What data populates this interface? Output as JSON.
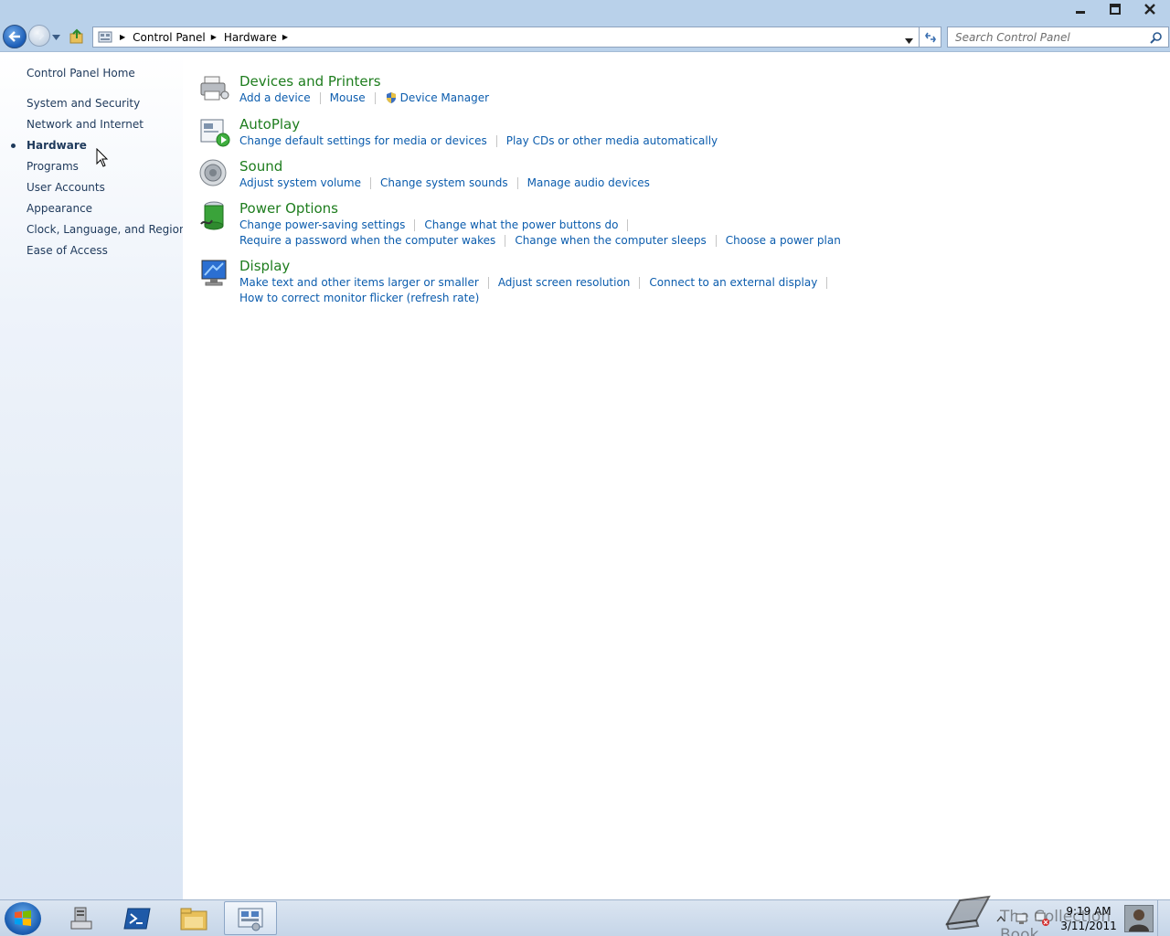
{
  "window": {
    "controls": [
      "minimize",
      "restore",
      "close"
    ]
  },
  "address_bar": {
    "breadcrumbs": [
      "Control Panel",
      "Hardware"
    ]
  },
  "search": {
    "placeholder": "Search Control Panel"
  },
  "sidebar": {
    "home": "Control Panel Home",
    "items": [
      {
        "label": "System and Security",
        "current": false
      },
      {
        "label": "Network and Internet",
        "current": false
      },
      {
        "label": "Hardware",
        "current": true
      },
      {
        "label": "Programs",
        "current": false
      },
      {
        "label": "User Accounts",
        "current": false
      },
      {
        "label": "Appearance",
        "current": false
      },
      {
        "label": "Clock, Language, and Region",
        "current": false
      },
      {
        "label": "Ease of Access",
        "current": false
      }
    ]
  },
  "categories": [
    {
      "title": "Devices and Printers",
      "icon": "printer-icon",
      "rows": [
        [
          "Add a device",
          "Mouse",
          "Device Manager"
        ]
      ]
    },
    {
      "title": "AutoPlay",
      "icon": "autoplay-icon",
      "rows": [
        [
          "Change default settings for media or devices",
          "Play CDs or other media automatically"
        ]
      ]
    },
    {
      "title": "Sound",
      "icon": "speaker-icon",
      "rows": [
        [
          "Adjust system volume",
          "Change system sounds",
          "Manage audio devices"
        ]
      ]
    },
    {
      "title": "Power Options",
      "icon": "battery-icon",
      "rows": [
        [
          "Change power-saving settings",
          "Change what the power buttons do"
        ],
        [
          "Require a password when the computer wakes",
          "Change when the computer sleeps",
          "Choose a power plan"
        ]
      ]
    },
    {
      "title": "Display",
      "icon": "monitor-icon",
      "rows": [
        [
          "Make text and other items larger or smaller",
          "Adjust screen resolution",
          "Connect to an external display"
        ],
        [
          "How to correct monitor flicker (refresh rate)"
        ]
      ]
    }
  ],
  "taskbar": {
    "clock_time": "9:19 AM",
    "clock_date": "3/11/2011",
    "watermark": "The Collection Book"
  },
  "colors": {
    "title_bar": "#b9d1ea",
    "category_title": "#1e7d1e",
    "task_link": "#0b5cad",
    "sidebar_text": "#1e395b"
  }
}
